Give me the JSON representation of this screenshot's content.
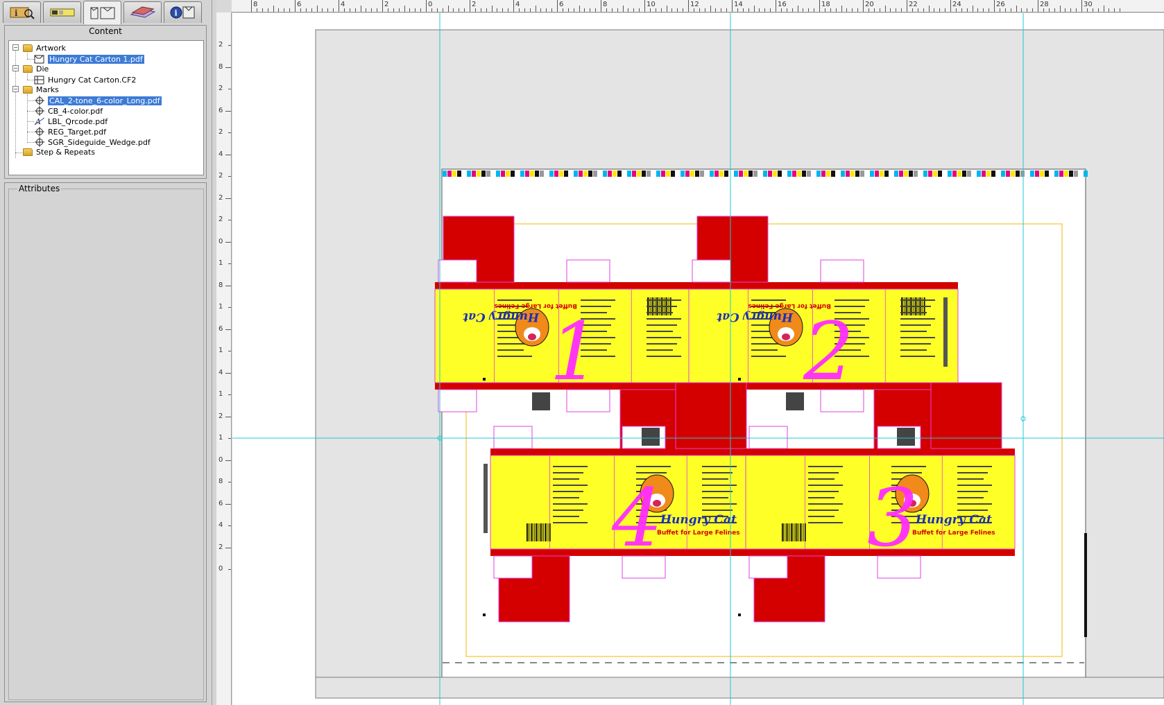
{
  "tabs": [
    {
      "name": "info-tab-icon",
      "label": ""
    },
    {
      "name": "marks-tab-icon",
      "label": ""
    },
    {
      "name": "content-tab-icon",
      "label": ""
    },
    {
      "name": "layout-tab-icon",
      "label": ""
    },
    {
      "name": "properties-tab-icon",
      "label": ""
    }
  ],
  "content": {
    "title": "Content",
    "folders": {
      "artwork": "Artwork",
      "die": "Die",
      "marks": "Marks",
      "step_repeats": "Step & Repeats"
    },
    "artwork_files": [
      "Hungry Cat Carton 1.pdf"
    ],
    "die_files": [
      "Hungry Cat Carton.CF2"
    ],
    "mark_files": [
      "CAL_2-tone_6-color_Long.pdf",
      "CB_4-color.pdf",
      "LBL_Qrcode.pdf",
      "REG_Target.pdf",
      "SGR_Sideguide_Wedge.pdf"
    ]
  },
  "attributes": {
    "title": "Attributes"
  },
  "ruler": {
    "top_labels": [
      "8",
      "6",
      "4",
      "2",
      "0",
      "2",
      "4",
      "6",
      "8",
      "10",
      "12",
      "14",
      "16",
      "18",
      "20",
      "22",
      "24",
      "26",
      "28",
      "30"
    ],
    "left_labels": [
      "2",
      "8",
      "2",
      "6",
      "2",
      "4",
      "2",
      "2",
      "2",
      "0",
      "1",
      "8",
      "1",
      "6",
      "1",
      "4",
      "1",
      "2",
      "1",
      "0",
      "8",
      "6",
      "4",
      "2",
      "0"
    ]
  },
  "cartons": [
    {
      "number": "1",
      "brand": "Hungry Cat",
      "tagline": "Buffet for Large Felines"
    },
    {
      "number": "2",
      "brand": "Hungry Cat",
      "tagline": "Buffet for Large Felines"
    },
    {
      "number": "3",
      "brand": "Hungry Cat",
      "tagline": "Buffet for Large Felines"
    },
    {
      "number": "4",
      "brand": "Hungry Cat",
      "tagline": "Buffet for Large Felines"
    }
  ],
  "colors": {
    "carton_red": "#d40000",
    "carton_yellow": "#ffff28",
    "die_line": "#e040e0",
    "guide": "#1fc8d4",
    "selection": "#3d7bd6",
    "number_magenta": "#ff2cff"
  }
}
